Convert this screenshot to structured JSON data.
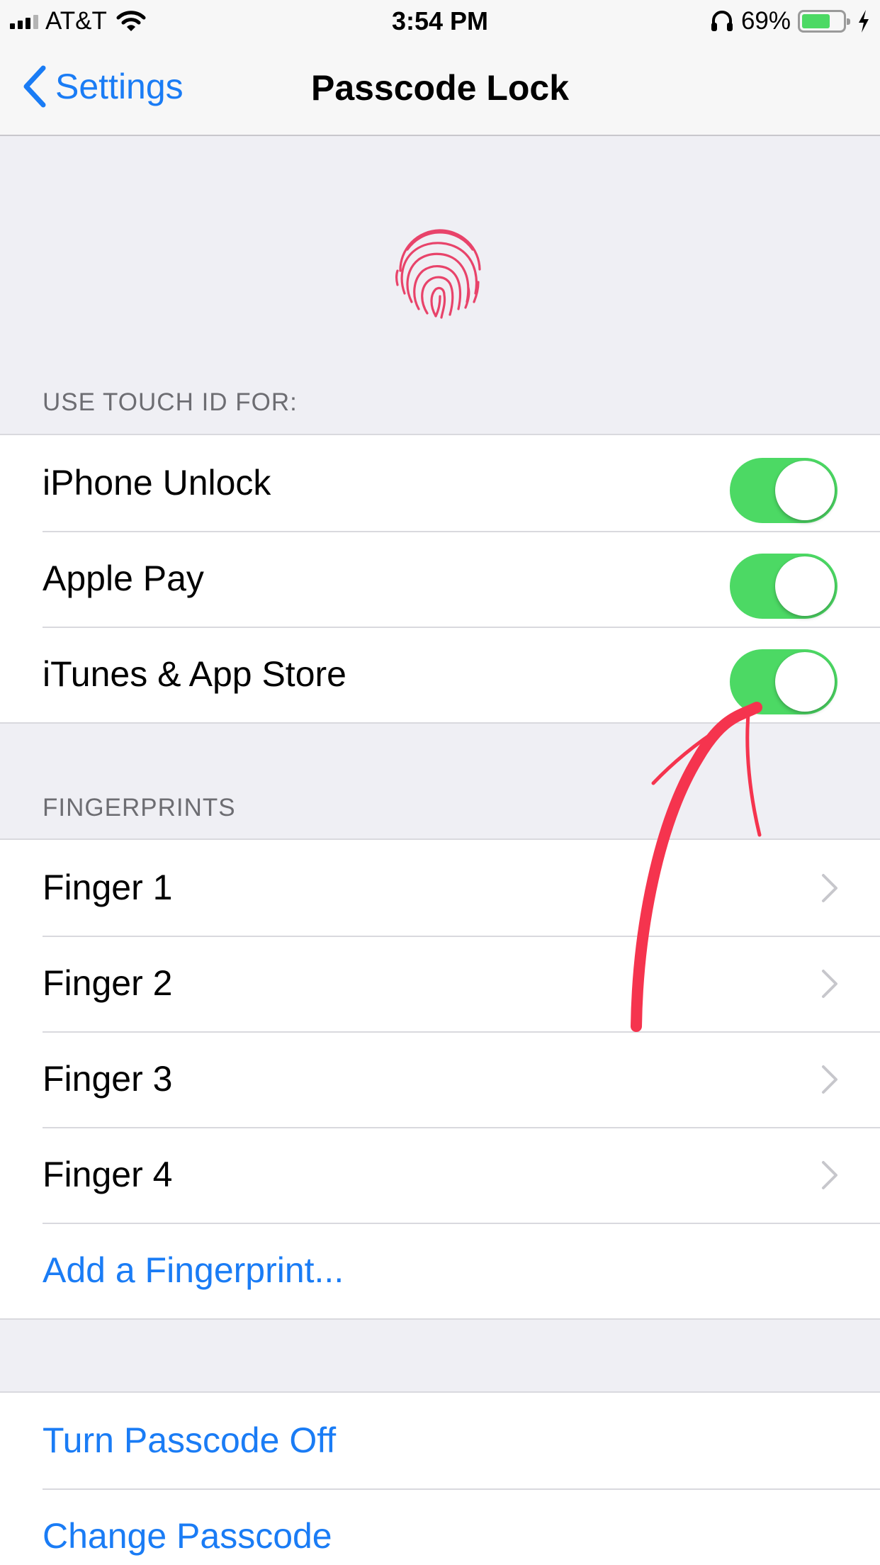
{
  "status_bar": {
    "carrier": "AT&T",
    "time": "3:54 PM",
    "battery_percent": "69%",
    "battery_level": 0.69,
    "icons": [
      "signal-icon",
      "wifi-icon",
      "headphones-icon",
      "battery-icon",
      "charging-bolt-icon"
    ]
  },
  "nav": {
    "back_label": "Settings",
    "title": "Passcode Lock"
  },
  "touch_id": {
    "header": "USE TOUCH ID FOR:",
    "items": [
      {
        "label": "iPhone Unlock",
        "on": true
      },
      {
        "label": "Apple Pay",
        "on": true
      },
      {
        "label": "iTunes & App Store",
        "on": true
      }
    ]
  },
  "fingerprints": {
    "header": "FINGERPRINTS",
    "items": [
      {
        "label": "Finger 1"
      },
      {
        "label": "Finger 2"
      },
      {
        "label": "Finger 3"
      },
      {
        "label": "Finger 4"
      }
    ],
    "add_label": "Add a Fingerprint..."
  },
  "passcode": {
    "turn_off_label": "Turn Passcode Off",
    "change_label": "Change Passcode"
  },
  "colors": {
    "accent": "#1a7cf5",
    "toggle_on": "#4cd964",
    "fingerprint": "#e8436a",
    "annotation": "#f5344e"
  }
}
